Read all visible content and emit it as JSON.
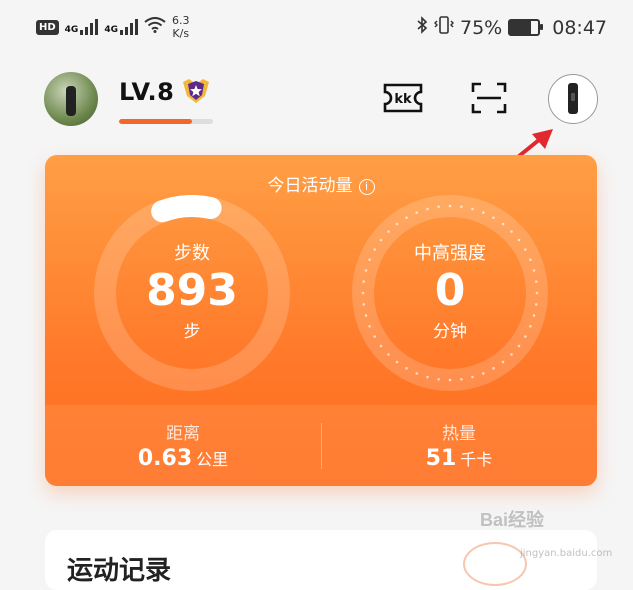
{
  "status_bar": {
    "hd_label": "HD",
    "sim1_label": "4G",
    "sim2_label": "4G",
    "net_speed_value": "6.3",
    "net_speed_unit": "K/s",
    "battery_percent": "75%",
    "battery_level": 0.75,
    "time": "08:47"
  },
  "header": {
    "level": "LV.8",
    "level_progress": 0.78,
    "kk_icon": "kk-ticket-icon",
    "scan_icon": "scan-icon",
    "device_icon": "band-device-icon"
  },
  "activity": {
    "title": "今日活动量",
    "steps": {
      "name": "步数",
      "value": "893",
      "unit": "步",
      "progress": 0.09
    },
    "intensity": {
      "name": "中高强度",
      "value": "0",
      "unit": "分钟"
    },
    "distance": {
      "label": "距离",
      "value": "0.63",
      "unit": "公里"
    },
    "calories": {
      "label": "热量",
      "value": "51",
      "unit": "千卡"
    }
  },
  "record": {
    "title": "运动记录"
  },
  "watermark": {
    "brand": "Bai经验",
    "sub": "jingyan.baidu.com"
  },
  "colors": {
    "accent": "#ff7a2a",
    "level_bar": "#f2682a",
    "arrow": "#e0282e"
  }
}
